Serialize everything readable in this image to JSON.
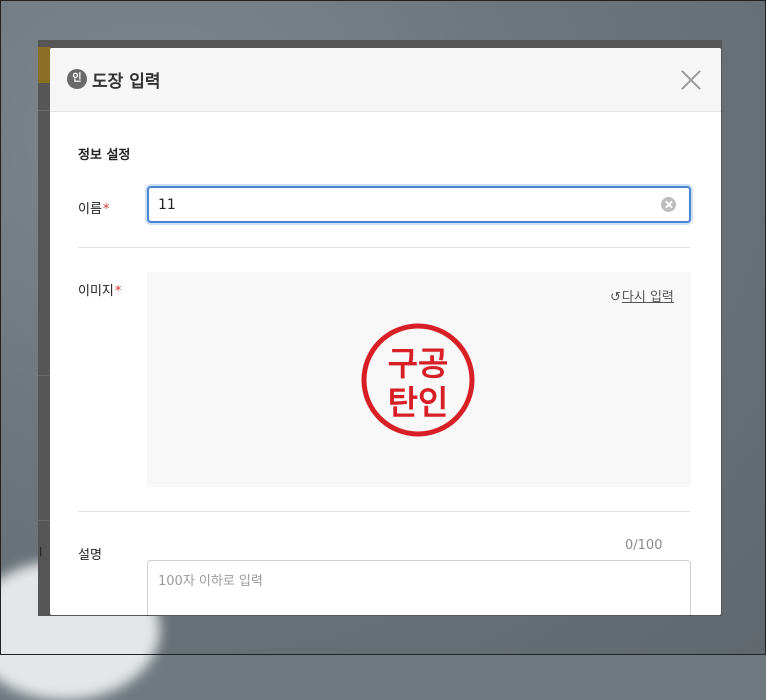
{
  "dialog": {
    "title": "도장 입력",
    "badge_text": "인",
    "section_title": "정보 설정",
    "name_field": {
      "label": "이름",
      "required_mark": "*",
      "value": "11"
    },
    "image_field": {
      "label": "이미지",
      "required_mark": "*",
      "reinput_icon": "↺",
      "reinput_label": "다시 입력",
      "stamp_line1": "구공",
      "stamp_line2": "탄인"
    },
    "description_field": {
      "label": "설명",
      "counter": "0/100",
      "placeholder": "100자 이하로 입력"
    }
  },
  "colors": {
    "accent_focus": "#4a84d4",
    "required": "#d0342c",
    "stamp_red": "#d81f26"
  }
}
